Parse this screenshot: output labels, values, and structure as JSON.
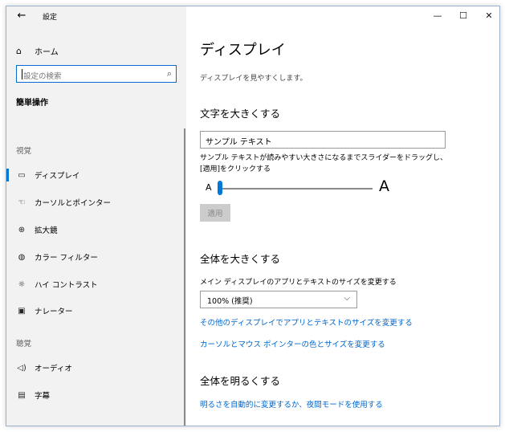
{
  "titlebar": {
    "back_icon": "←",
    "title": "設定",
    "minimize": "—",
    "maximize": "☐",
    "close": "✕"
  },
  "sidebar": {
    "home": {
      "icon": "⌂",
      "label": "ホーム"
    },
    "search": {
      "placeholder": "設定の検索",
      "icon": "⌕"
    },
    "section_title": "簡単操作",
    "groups": [
      {
        "heading": "視覚",
        "items": [
          {
            "icon": "▭",
            "label": "ディスプレイ",
            "active": true
          },
          {
            "icon": "☜",
            "label": "カーソルとポインター"
          },
          {
            "icon": "⊕",
            "label": "拡大鏡"
          },
          {
            "icon": "◍",
            "label": "カラー フィルター"
          },
          {
            "icon": "☼",
            "label": "ハイ コントラスト"
          },
          {
            "icon": "▣",
            "label": "ナレーター"
          }
        ]
      },
      {
        "heading": "聴覚",
        "items": [
          {
            "icon": "◁)",
            "label": "オーディオ"
          },
          {
            "icon": "▤",
            "label": "字幕"
          }
        ]
      }
    ]
  },
  "main": {
    "title": "ディスプレイ",
    "subtitle": "ディスプレイを見やすくします。",
    "text_size": {
      "heading": "文字を大きくする",
      "sample": "サンプル テキスト",
      "description": "サンプル テキストが読みやすい大きさになるまでスライダーをドラッグし、[適用]をクリックする",
      "small_a": "A",
      "large_a": "A",
      "slider_value_fraction": 0.0,
      "apply": "適用"
    },
    "everything_bigger": {
      "heading": "全体を大きくする",
      "label": "メイン ディスプレイのアプリとテキストのサイズを変更する",
      "selected": "100% (推奨)",
      "link1": "その他のディスプレイでアプリとテキストのサイズを変更する",
      "link2": "カーソルとマウス ポインターの色とサイズを変更する"
    },
    "brightness": {
      "heading": "全体を明るくする",
      "link": "明るさを自動的に変更するか、夜間モードを使用する"
    }
  },
  "colors": {
    "accent": "#0078d7",
    "link": "#0066cc",
    "sidebar_bg": "#f2f2f2"
  }
}
